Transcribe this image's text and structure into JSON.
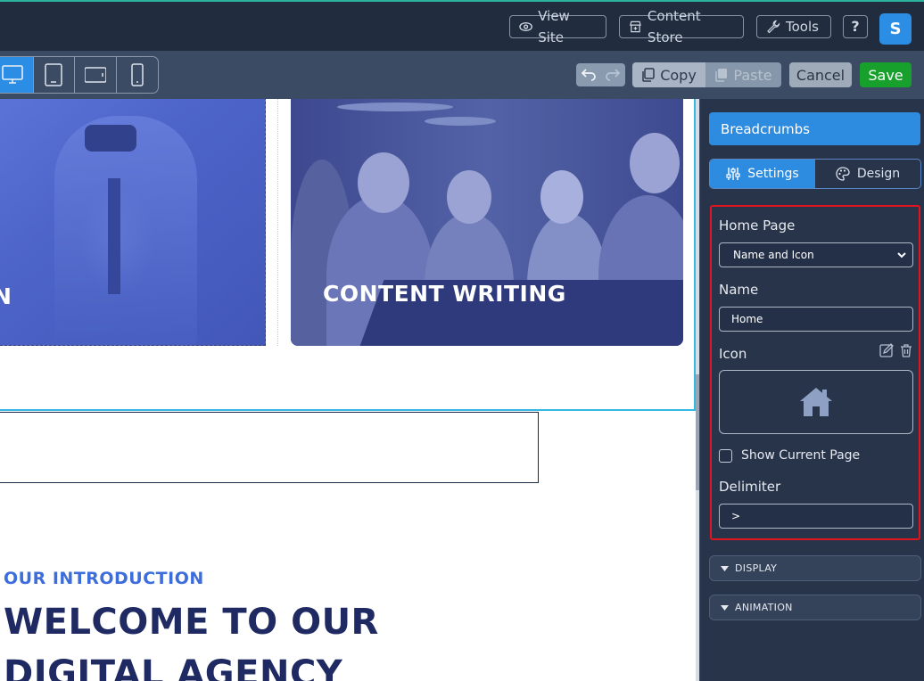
{
  "topbar": {
    "view_site": "View Site",
    "content_store": "Content Store",
    "tools": "Tools",
    "help": "?",
    "avatar": "S"
  },
  "toolbar": {
    "copy": "Copy",
    "paste": "Paste",
    "cancel": "Cancel",
    "save": "Save"
  },
  "canvas": {
    "card_left_title": "GN",
    "card_right_title": "CONTENT WRITING",
    "intro_kicker": "OUR INTRODUCTION",
    "intro_title": "WELCOME TO OUR DIGITAL AGENCY"
  },
  "panel": {
    "header": "Breadcrumbs",
    "tabs": [
      {
        "label": "Settings",
        "icon": "sliders-icon",
        "active": true
      },
      {
        "label": "Design",
        "icon": "palette-icon",
        "active": false
      }
    ],
    "home_page_label": "Home Page",
    "home_page_value": "Name and Icon",
    "name_label": "Name",
    "name_value": "Home",
    "icon_label": "Icon",
    "show_current_label": "Show Current Page",
    "delimiter_label": "Delimiter",
    "delimiter_value": ">",
    "sections": [
      "DISPLAY",
      "ANIMATION"
    ]
  },
  "colors": {
    "accent": "#2d8be0",
    "save": "#17a02b",
    "selection": "#35b7e5",
    "highlight_border": "#e0151f"
  }
}
